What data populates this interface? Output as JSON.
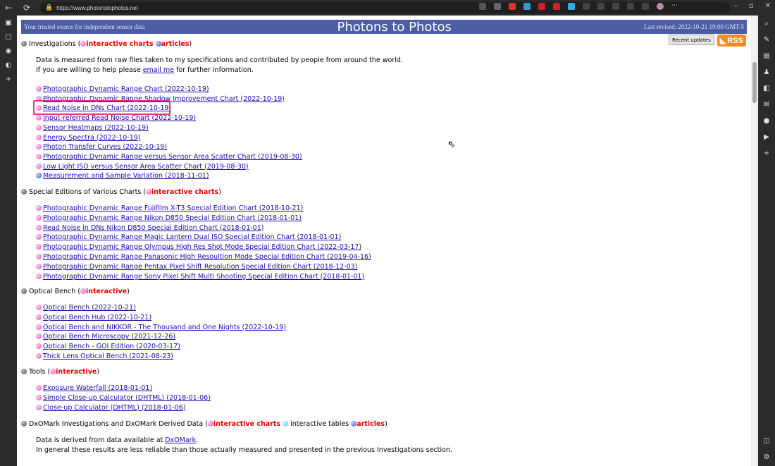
{
  "browser": {
    "url": "https://www.photonstophotos.net",
    "lock_icon": "lock-icon"
  },
  "banner": {
    "left": "Your trusted source for independent sensor data",
    "title": "Photons to Photos",
    "right": "Last revised: 2022-10-21 19:00 GMT-5",
    "bg": "#4c5da6"
  },
  "buttons": {
    "recent": "Recent updates",
    "rss": "RSS"
  },
  "investigations": {
    "title": "Investigations (",
    "charts_label": "interactive charts",
    "articles_label": "articles",
    "close": ")",
    "para1": "Data is measured from raw files taken to my specifications and contributed by people from around the world.",
    "para2_pre": "If you are willing to help please ",
    "para2_link": "email me",
    "para2_post": " for further information.",
    "items": [
      {
        "label": "Photographic Dynamic Range Chart (2022-10-19)",
        "bullet": "pink"
      },
      {
        "label": "Photographic Dynamic Range Shadow Improvement Chart (2022-10-19)",
        "bullet": "pink"
      },
      {
        "label": "Read Noise in DNs Chart (2022-10-19)",
        "bullet": "pink"
      },
      {
        "label": "Input-referred Read Noise Chart (2022-10-19)",
        "bullet": "pink"
      },
      {
        "label": "Sensor Heatmaps (2022-10-19)",
        "bullet": "pink"
      },
      {
        "label": "Energy Spectra (2022-10-19)",
        "bullet": "pink"
      },
      {
        "label": "Photon Transfer Curves (2022-10-19)",
        "bullet": "pink"
      },
      {
        "label": "Photographic Dynamic Range versus Sensor Area Scatter Chart (2019-08-30)",
        "bullet": "pink"
      },
      {
        "label": "Low Light ISO versus Sensor Area Scatter Chart (2019-08-30)",
        "bullet": "pink"
      },
      {
        "label": "Measurement and Sample Variation (2018-11-01)",
        "bullet": "blue"
      }
    ]
  },
  "special": {
    "title": "Special Editions of Various Charts (",
    "charts_label": "interactive charts",
    "close": ")",
    "items": [
      "Photographic Dynamic Range Fujifilm X-T3 Special Edition Chart (2018-10-21)",
      "Photographic Dynamic Range Nikon D850 Special Edition Chart (2018-01-01)",
      "Read Noise in DNs Nikon D850 Special Edition Chart (2018-01-01)",
      "Photographic Dynamic Range Magic Lantern Dual ISO Special Edition Chart (2018-01-01)",
      "Photographic Dynamic Range Olympus High Res Shot Mode Special Edition Chart (2022-03-17)",
      "Photographic Dynamic Range Panasonic High Resoultion Mode Special Edition Chart (2019-04-16)",
      "Photographic Dynamic Range Pentax Pixel Shift Resolution Special Edition Chart (2018-12-03)",
      "Photographic Dynamic Range Sony Pixel Shift Multi Shooting Special Edition Chart (2018-01-01)"
    ]
  },
  "optical": {
    "title": "Optical Bench (",
    "label": "interactive",
    "close": ")",
    "items": [
      "Optical Bench (2022-10-21)",
      "Optical Bench Hub (2022-10-21)",
      "Optical Bench and NIKKOR - The Thousand and One Nights (2022-10-19)",
      "Optical Bench Microscopy (2021-12-26)",
      "Optical Bench - GOI Edition (2020-03-17)",
      "Thick Lens Optical Bench (2021-08-23)"
    ]
  },
  "tools": {
    "title": "Tools (",
    "label": "interactive",
    "close": ")",
    "items": [
      "Exposure Waterfall (2018-01-01)",
      "Simple Close-up Calculator (DHTML) (2018-01-06)",
      "Close-up Calculator (DHTML) (2018-01-06)"
    ]
  },
  "dxo": {
    "title": "DxOMark Investigations and DxOMark Derived Data (",
    "charts_label": "interactive charts",
    "tables_label": " interactive tables ",
    "articles_label": "articles",
    "close": ")",
    "para1_pre": "Data is derived from data available at ",
    "para1_link": "DxOMark",
    "para1_post": ".",
    "para2": "In general these results are less reliable than those actually measured and presented in the previous Investigations section."
  }
}
